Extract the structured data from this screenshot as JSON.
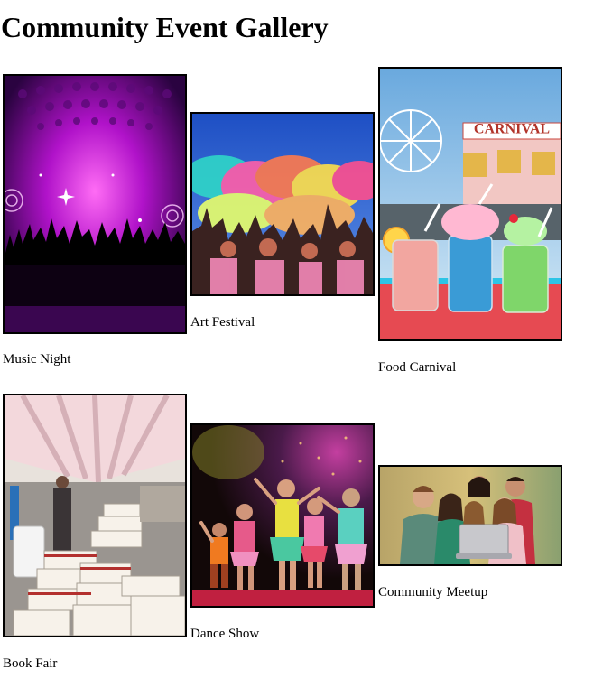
{
  "page": {
    "title": "Community Event Gallery"
  },
  "gallery": {
    "items": [
      {
        "caption": "Music Night",
        "image": "concert-crowd-photo"
      },
      {
        "caption": "Art Festival",
        "image": "color-powder-festival-photo"
      },
      {
        "caption": "Food Carnival",
        "image": "carnival-drinks-photo",
        "image_text": "CARNIVAL"
      },
      {
        "caption": "Book Fair",
        "image": "book-stalls-tent-photo"
      },
      {
        "caption": "Dance Show",
        "image": "kids-dance-stage-photo"
      },
      {
        "caption": "Community Meetup",
        "image": "friends-laptop-group-photo"
      }
    ]
  }
}
